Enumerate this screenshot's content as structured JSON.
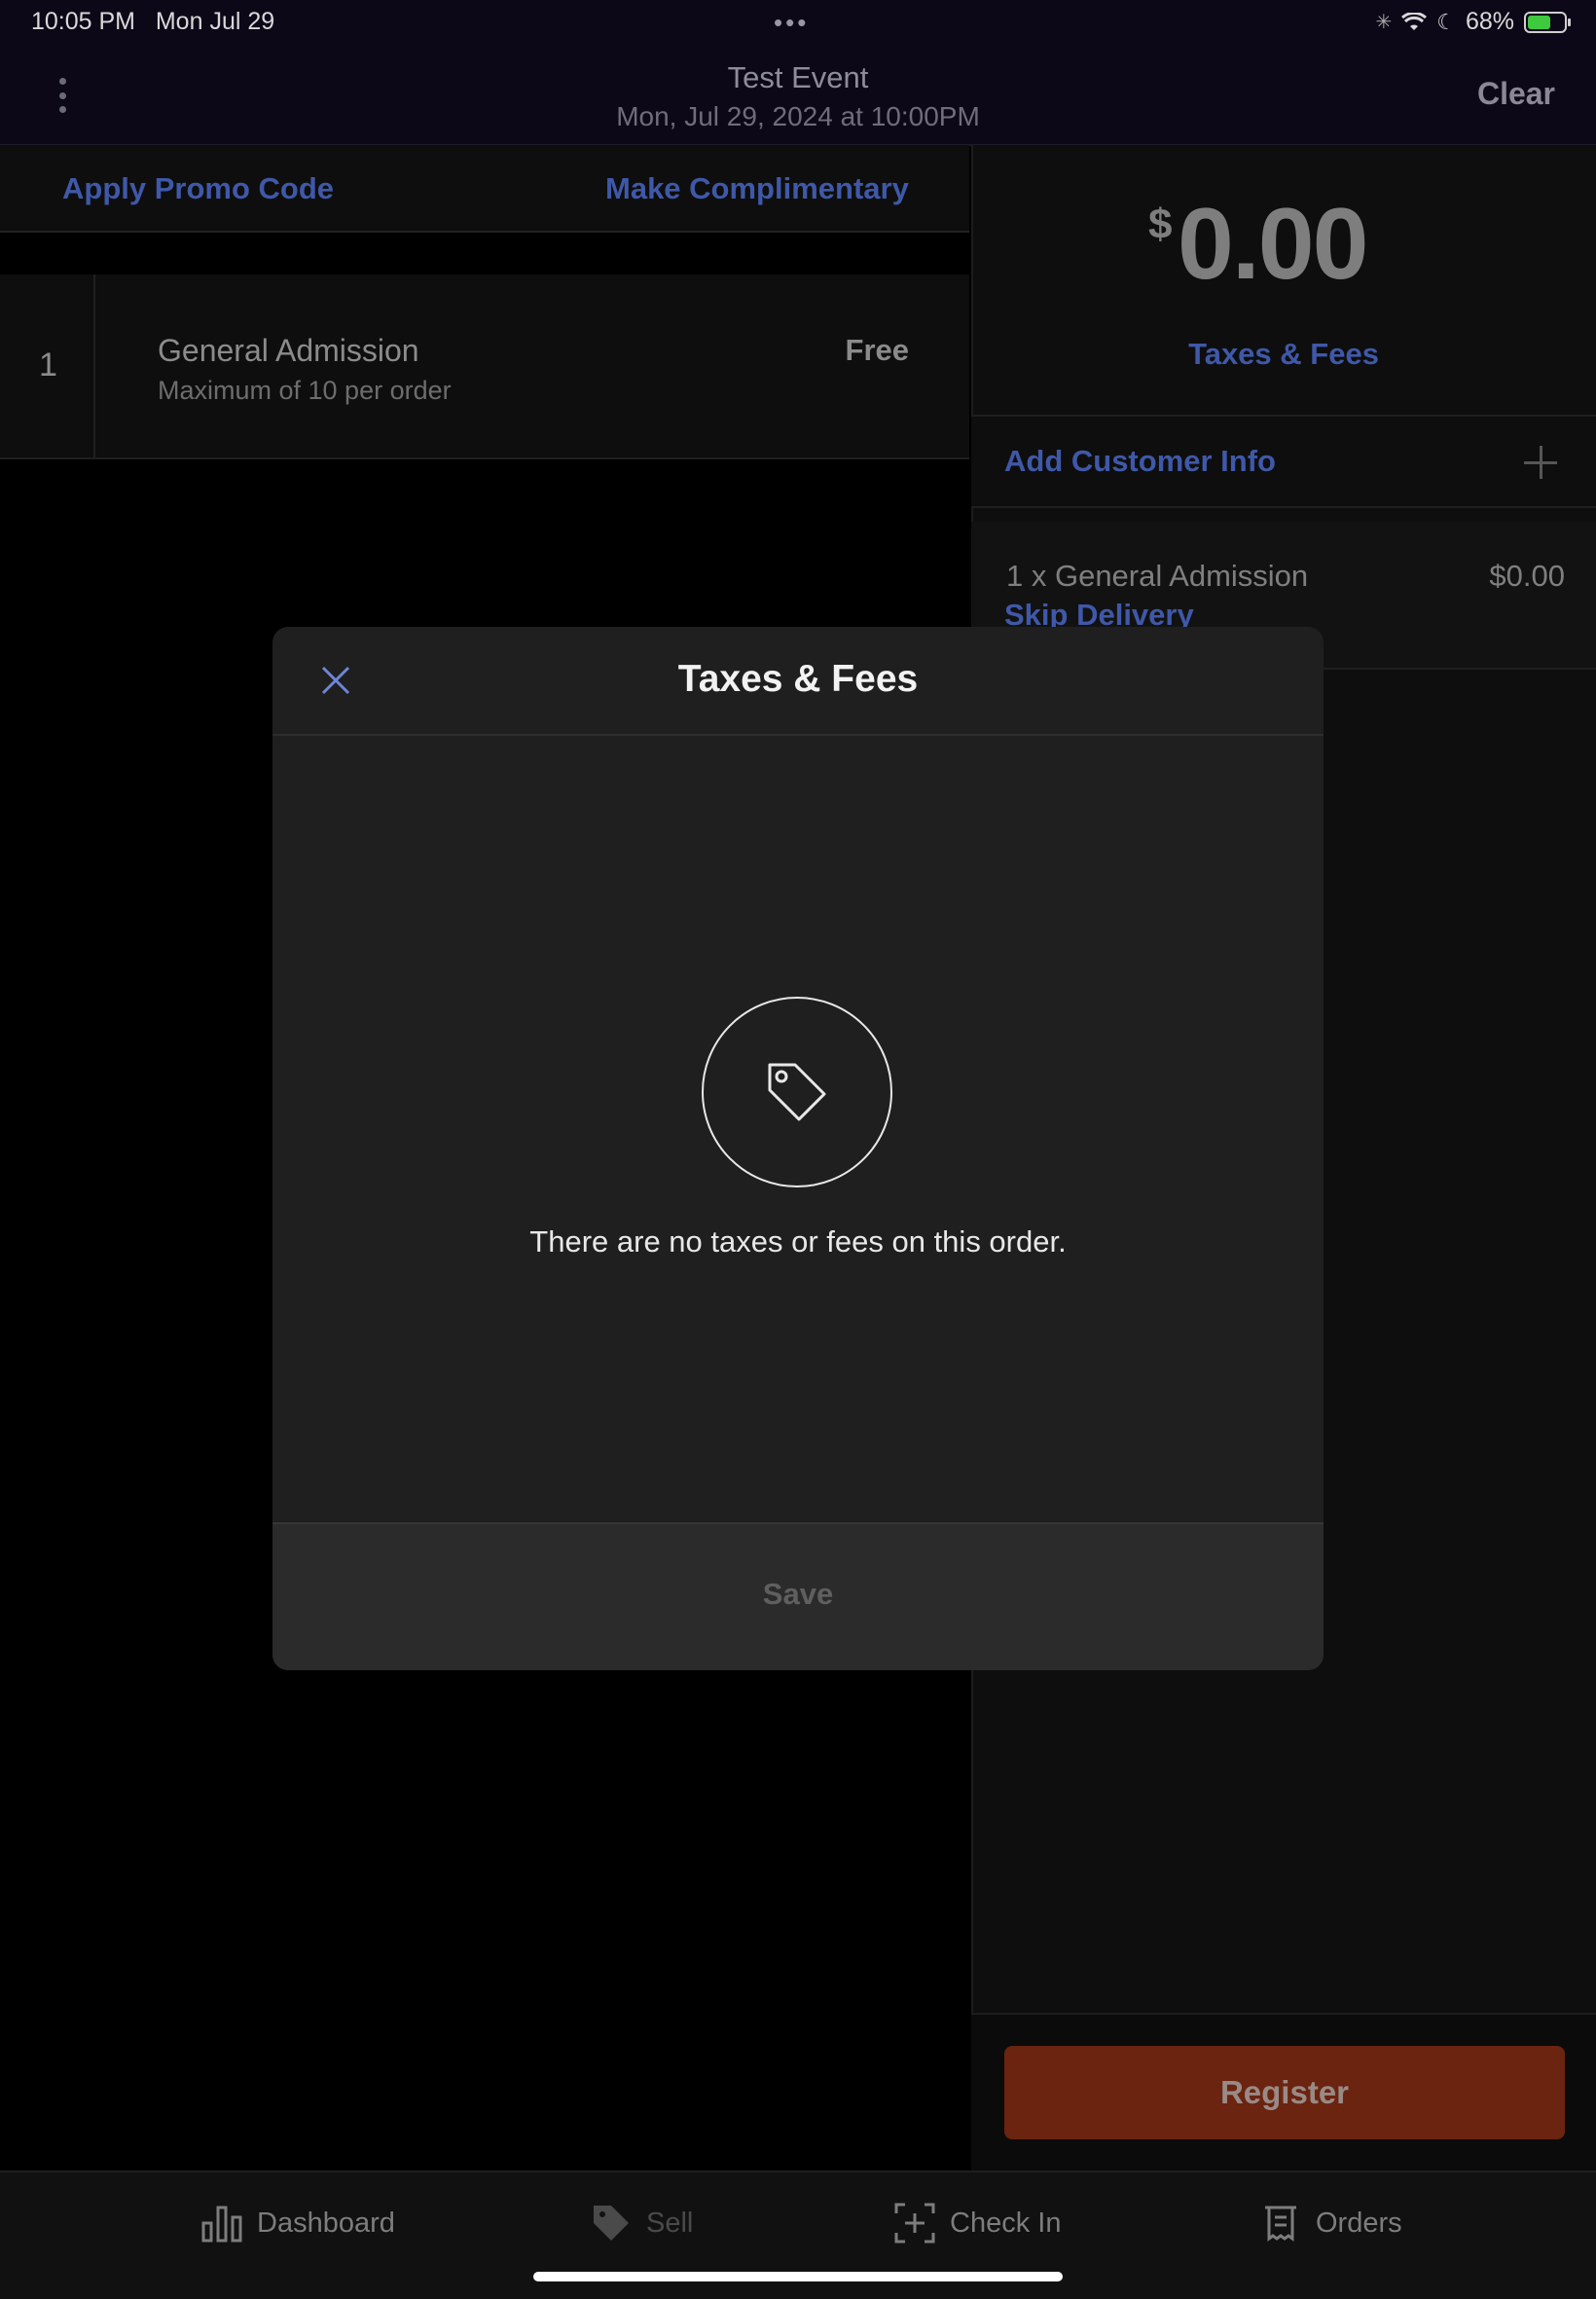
{
  "status_bar": {
    "time": "10:05 PM",
    "date": "Mon Jul 29",
    "dots": "•••",
    "battery_text": "68%",
    "battery_level": 0.68
  },
  "header": {
    "event_title": "Test Event",
    "event_date": "Mon, Jul 29, 2024 at 10:00PM",
    "clear_label": "Clear"
  },
  "actions": {
    "promo": "Apply Promo Code",
    "complimentary": "Make Complimentary"
  },
  "ticket": {
    "qty": "1",
    "name": "General Admission",
    "subtitle": "Maximum of 10 per order",
    "price": "Free"
  },
  "summary": {
    "currency_symbol": "$",
    "total": "0.00",
    "taxes_fees_link": "Taxes & Fees",
    "add_customer": "Add Customer Info",
    "item_label": "1 x General Admission",
    "item_price": "$0.00",
    "skip_delivery": "Skip Delivery",
    "register": "Register"
  },
  "modal": {
    "title": "Taxes & Fees",
    "empty_message": "There are no taxes or fees on this order.",
    "save": "Save",
    "icon": "price-tag-icon"
  },
  "tabs": [
    {
      "label": "Dashboard",
      "icon": "bar-chart-icon"
    },
    {
      "label": "Sell",
      "icon": "tag-icon"
    },
    {
      "label": "Check In",
      "icon": "scan-plus-icon"
    },
    {
      "label": "Orders",
      "icon": "receipt-icon"
    }
  ],
  "colors": {
    "link_blue": "#3f58a8",
    "register_orange": "#6a2410",
    "header_bg": "#0d0818"
  }
}
